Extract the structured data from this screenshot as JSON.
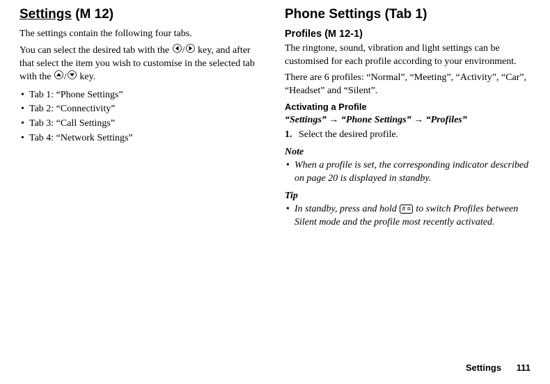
{
  "left": {
    "title_main": "Settings",
    "title_menu": "(M 12)",
    "intro": "The settings contain the following four tabs.",
    "instruction_1": "You can select the desired tab with the ",
    "instruction_2": " key, and after that select the item you wish to customise in the selected tab with the ",
    "instruction_3": " key.",
    "tabs": [
      "Tab 1: “Phone Settings”",
      "Tab 2: “Connectivity”",
      "Tab 3: “Call Settings”",
      "Tab 4: “Network Settings”"
    ]
  },
  "right": {
    "h2_title": "Phone Settings",
    "h2_tab": "(Tab 1)",
    "h3_title": "Profiles",
    "h3_menu": "(M 12-1)",
    "p1": "The ringtone, sound, vibration and light settings can be customised for each profile according to your environment.",
    "p2": "There are 6 profiles: “Normal”, “Meeting”, “Activity”, “Car”, “Headset” and “Silent”.",
    "h4": "Activating a Profile",
    "path_1": "“Settings”",
    "path_2": "“Phone Settings”",
    "path_3": "“Profiles”",
    "arrow": " → ",
    "step_num": "1.",
    "step_text": "Select the desired profile.",
    "note_label": "Note",
    "note_text": "When a profile is set, the corresponding indicator described on page 20 is displayed in standby.",
    "tip_label": "Tip",
    "tip_text_1": "In standby, press and hold ",
    "tip_text_2": " to switch Profiles between Silent mode and the profile most recently activated.",
    "hash_key": "# ¤"
  },
  "footer": {
    "label": "Settings",
    "page": "111"
  }
}
